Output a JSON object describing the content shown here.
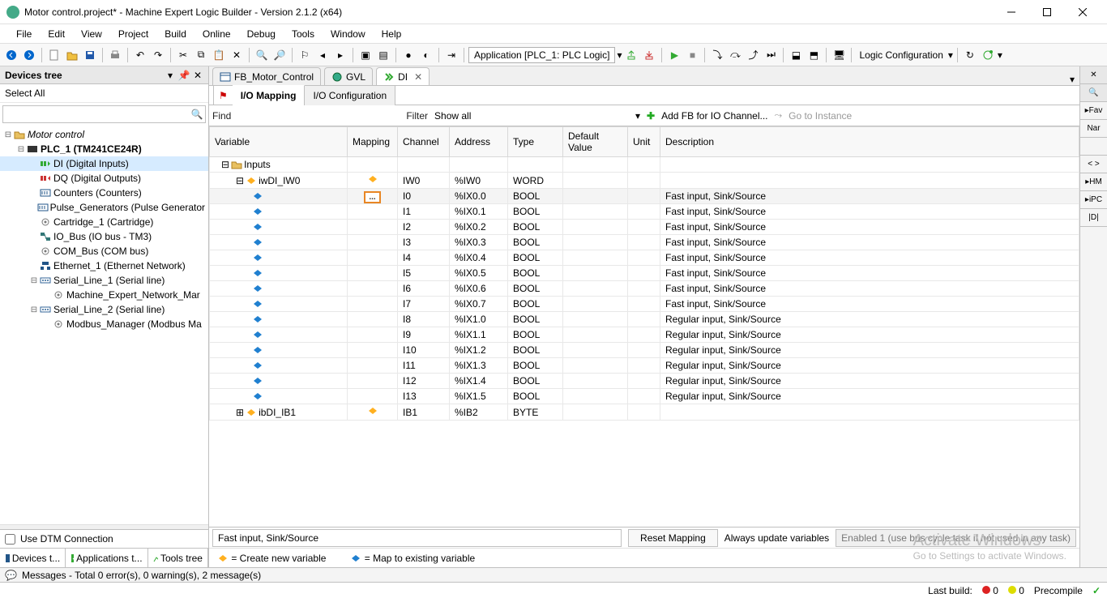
{
  "title": "Motor control.project* - Machine Expert Logic Builder - Version 2.1.2 (x64)",
  "menubar": [
    "File",
    "Edit",
    "View",
    "Project",
    "Build",
    "Online",
    "Debug",
    "Tools",
    "Window",
    "Help"
  ],
  "toolbar_logic_app": "Application [PLC_1: PLC Logic]",
  "toolbar_logic_cfg": "Logic Configuration",
  "left": {
    "panel_title": "Devices tree",
    "select_all": "Select All",
    "tree": [
      {
        "lvl": 0,
        "exp": "-",
        "icon": "folder",
        "label": "Motor control",
        "italic": true
      },
      {
        "lvl": 1,
        "exp": "-",
        "icon": "plc",
        "label": "PLC_1 (TM241CE24R)",
        "bold": true
      },
      {
        "lvl": 2,
        "exp": "",
        "icon": "di",
        "label": "DI (Digital Inputs)",
        "sel": true
      },
      {
        "lvl": 2,
        "exp": "",
        "icon": "do",
        "label": "DQ (Digital Outputs)"
      },
      {
        "lvl": 2,
        "exp": "",
        "icon": "ctr",
        "label": "Counters (Counters)"
      },
      {
        "lvl": 2,
        "exp": "",
        "icon": "ctr",
        "label": "Pulse_Generators (Pulse Generator"
      },
      {
        "lvl": 2,
        "exp": "",
        "icon": "gear",
        "label": "Cartridge_1 (Cartridge)"
      },
      {
        "lvl": 2,
        "exp": "",
        "icon": "net2",
        "label": "IO_Bus (IO bus - TM3)"
      },
      {
        "lvl": 2,
        "exp": "",
        "icon": "gear",
        "label": "COM_Bus (COM bus)"
      },
      {
        "lvl": 2,
        "exp": "",
        "icon": "net",
        "label": "Ethernet_1 (Ethernet Network)"
      },
      {
        "lvl": 2,
        "exp": "-",
        "icon": "ser",
        "label": "Serial_Line_1 (Serial line)"
      },
      {
        "lvl": 3,
        "exp": "",
        "icon": "gear",
        "label": "Machine_Expert_Network_Mar"
      },
      {
        "lvl": 2,
        "exp": "-",
        "icon": "ser",
        "label": "Serial_Line_2 (Serial line)"
      },
      {
        "lvl": 3,
        "exp": "",
        "icon": "gear",
        "label": "Modbus_Manager (Modbus Ma"
      }
    ],
    "dtm_label": "Use DTM Connection",
    "tabs": [
      {
        "label": "Devices t..."
      },
      {
        "label": "Applications t..."
      },
      {
        "label": "Tools tree"
      }
    ]
  },
  "doc_tabs": [
    {
      "label": "FB_Motor_Control",
      "icon": "fb"
    },
    {
      "label": "GVL",
      "icon": "gvl"
    },
    {
      "label": "DI",
      "icon": "di",
      "active": true,
      "closable": true
    }
  ],
  "sub_tabs": [
    {
      "label": "I/O Mapping",
      "active": true
    },
    {
      "label": "I/O Configuration"
    }
  ],
  "findbar": {
    "find": "Find",
    "filter": "Filter",
    "filter_val": "Show all",
    "add_fb": "Add FB for IO Channel...",
    "goto": "Go to Instance"
  },
  "columns": [
    "Variable",
    "Mapping",
    "Channel",
    "Address",
    "Type",
    "Default Value",
    "Unit",
    "Description"
  ],
  "rows": [
    {
      "ind": 0,
      "exp": "-",
      "icon": "folder",
      "var": "Inputs"
    },
    {
      "ind": 1,
      "exp": "-",
      "icon": "map-new",
      "var": "iwDI_IW0",
      "map": "new",
      "ch": "IW0",
      "addr": "%IW0",
      "type": "WORD"
    },
    {
      "ind": 2,
      "icon": "map-ex",
      "sel": true,
      "ellipsis": true,
      "ch": "I0",
      "addr": "%IX0.0",
      "type": "BOOL",
      "desc": "Fast input, Sink/Source"
    },
    {
      "ind": 2,
      "icon": "map-ex",
      "ch": "I1",
      "addr": "%IX0.1",
      "type": "BOOL",
      "desc": "Fast input, Sink/Source"
    },
    {
      "ind": 2,
      "icon": "map-ex",
      "ch": "I2",
      "addr": "%IX0.2",
      "type": "BOOL",
      "desc": "Fast input, Sink/Source"
    },
    {
      "ind": 2,
      "icon": "map-ex",
      "ch": "I3",
      "addr": "%IX0.3",
      "type": "BOOL",
      "desc": "Fast input, Sink/Source"
    },
    {
      "ind": 2,
      "icon": "map-ex",
      "ch": "I4",
      "addr": "%IX0.4",
      "type": "BOOL",
      "desc": "Fast input, Sink/Source"
    },
    {
      "ind": 2,
      "icon": "map-ex",
      "ch": "I5",
      "addr": "%IX0.5",
      "type": "BOOL",
      "desc": "Fast input, Sink/Source"
    },
    {
      "ind": 2,
      "icon": "map-ex",
      "ch": "I6",
      "addr": "%IX0.6",
      "type": "BOOL",
      "desc": "Fast input, Sink/Source"
    },
    {
      "ind": 2,
      "icon": "map-ex",
      "ch": "I7",
      "addr": "%IX0.7",
      "type": "BOOL",
      "desc": "Fast input, Sink/Source"
    },
    {
      "ind": 2,
      "icon": "map-ex",
      "ch": "I8",
      "addr": "%IX1.0",
      "type": "BOOL",
      "desc": "Regular input, Sink/Source"
    },
    {
      "ind": 2,
      "icon": "map-ex",
      "ch": "I9",
      "addr": "%IX1.1",
      "type": "BOOL",
      "desc": "Regular input, Sink/Source"
    },
    {
      "ind": 2,
      "icon": "map-ex",
      "ch": "I10",
      "addr": "%IX1.2",
      "type": "BOOL",
      "desc": "Regular input, Sink/Source"
    },
    {
      "ind": 2,
      "icon": "map-ex",
      "ch": "I11",
      "addr": "%IX1.3",
      "type": "BOOL",
      "desc": "Regular input, Sink/Source"
    },
    {
      "ind": 2,
      "icon": "map-ex",
      "ch": "I12",
      "addr": "%IX1.4",
      "type": "BOOL",
      "desc": "Regular input, Sink/Source"
    },
    {
      "ind": 2,
      "icon": "map-ex",
      "ch": "I13",
      "addr": "%IX1.5",
      "type": "BOOL",
      "desc": "Regular input, Sink/Source"
    },
    {
      "ind": 1,
      "exp": "+",
      "icon": "map-new",
      "var": "ibDI_IB1",
      "map": "new",
      "ch": "IB1",
      "addr": "%IB2",
      "type": "BYTE"
    }
  ],
  "bottom": {
    "status": "Fast input, Sink/Source",
    "reset": "Reset Mapping",
    "always": "Always update variables",
    "update_mode": "Enabled 1 (use bus cycle task if not used in any task)"
  },
  "legend": {
    "create": "= Create new variable",
    "map": "= Map to existing variable"
  },
  "right": {
    "items": [
      "✕",
      "🔍",
      "▸Fav",
      "Nar",
      "",
      "< >",
      "▸HM",
      "▸iPC",
      "|D|"
    ]
  },
  "msgbar": "Messages - Total 0 error(s), 0 warning(s), 2 message(s)",
  "statusbar": {
    "lastbuild": "Last build:",
    "err": "0",
    "warn": "0",
    "precompile": "Precompile",
    "check": "✓"
  },
  "watermark": {
    "l1": "Activate Windows",
    "l2": "Go to Settings to activate Windows."
  }
}
